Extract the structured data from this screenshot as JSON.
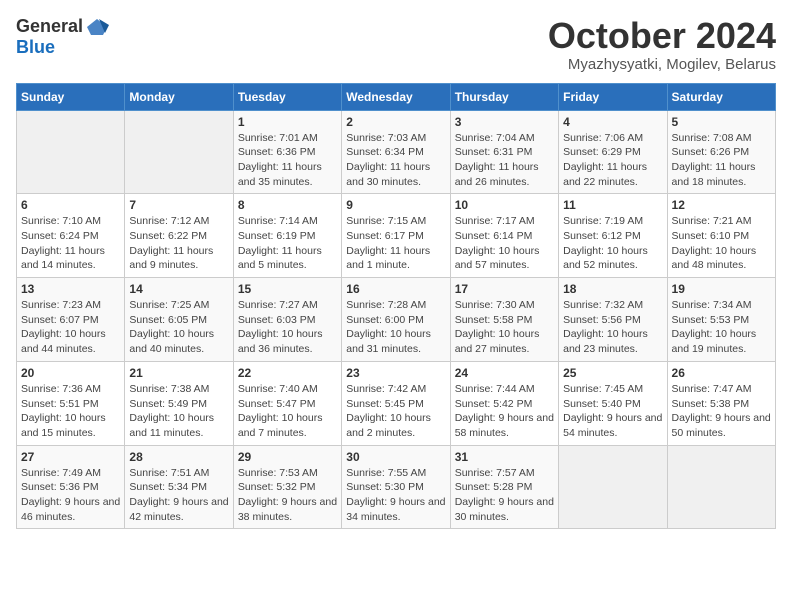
{
  "header": {
    "logo_general": "General",
    "logo_blue": "Blue",
    "month_title": "October 2024",
    "subtitle": "Myazhysyatki, Mogilev, Belarus"
  },
  "weekdays": [
    "Sunday",
    "Monday",
    "Tuesday",
    "Wednesday",
    "Thursday",
    "Friday",
    "Saturday"
  ],
  "weeks": [
    [
      {
        "num": "",
        "sunrise": "",
        "sunset": "",
        "daylight": "",
        "empty": true
      },
      {
        "num": "",
        "sunrise": "",
        "sunset": "",
        "daylight": "",
        "empty": true
      },
      {
        "num": "1",
        "sunrise": "Sunrise: 7:01 AM",
        "sunset": "Sunset: 6:36 PM",
        "daylight": "Daylight: 11 hours and 35 minutes.",
        "empty": false
      },
      {
        "num": "2",
        "sunrise": "Sunrise: 7:03 AM",
        "sunset": "Sunset: 6:34 PM",
        "daylight": "Daylight: 11 hours and 30 minutes.",
        "empty": false
      },
      {
        "num": "3",
        "sunrise": "Sunrise: 7:04 AM",
        "sunset": "Sunset: 6:31 PM",
        "daylight": "Daylight: 11 hours and 26 minutes.",
        "empty": false
      },
      {
        "num": "4",
        "sunrise": "Sunrise: 7:06 AM",
        "sunset": "Sunset: 6:29 PM",
        "daylight": "Daylight: 11 hours and 22 minutes.",
        "empty": false
      },
      {
        "num": "5",
        "sunrise": "Sunrise: 7:08 AM",
        "sunset": "Sunset: 6:26 PM",
        "daylight": "Daylight: 11 hours and 18 minutes.",
        "empty": false
      }
    ],
    [
      {
        "num": "6",
        "sunrise": "Sunrise: 7:10 AM",
        "sunset": "Sunset: 6:24 PM",
        "daylight": "Daylight: 11 hours and 14 minutes.",
        "empty": false
      },
      {
        "num": "7",
        "sunrise": "Sunrise: 7:12 AM",
        "sunset": "Sunset: 6:22 PM",
        "daylight": "Daylight: 11 hours and 9 minutes.",
        "empty": false
      },
      {
        "num": "8",
        "sunrise": "Sunrise: 7:14 AM",
        "sunset": "Sunset: 6:19 PM",
        "daylight": "Daylight: 11 hours and 5 minutes.",
        "empty": false
      },
      {
        "num": "9",
        "sunrise": "Sunrise: 7:15 AM",
        "sunset": "Sunset: 6:17 PM",
        "daylight": "Daylight: 11 hours and 1 minute.",
        "empty": false
      },
      {
        "num": "10",
        "sunrise": "Sunrise: 7:17 AM",
        "sunset": "Sunset: 6:14 PM",
        "daylight": "Daylight: 10 hours and 57 minutes.",
        "empty": false
      },
      {
        "num": "11",
        "sunrise": "Sunrise: 7:19 AM",
        "sunset": "Sunset: 6:12 PM",
        "daylight": "Daylight: 10 hours and 52 minutes.",
        "empty": false
      },
      {
        "num": "12",
        "sunrise": "Sunrise: 7:21 AM",
        "sunset": "Sunset: 6:10 PM",
        "daylight": "Daylight: 10 hours and 48 minutes.",
        "empty": false
      }
    ],
    [
      {
        "num": "13",
        "sunrise": "Sunrise: 7:23 AM",
        "sunset": "Sunset: 6:07 PM",
        "daylight": "Daylight: 10 hours and 44 minutes.",
        "empty": false
      },
      {
        "num": "14",
        "sunrise": "Sunrise: 7:25 AM",
        "sunset": "Sunset: 6:05 PM",
        "daylight": "Daylight: 10 hours and 40 minutes.",
        "empty": false
      },
      {
        "num": "15",
        "sunrise": "Sunrise: 7:27 AM",
        "sunset": "Sunset: 6:03 PM",
        "daylight": "Daylight: 10 hours and 36 minutes.",
        "empty": false
      },
      {
        "num": "16",
        "sunrise": "Sunrise: 7:28 AM",
        "sunset": "Sunset: 6:00 PM",
        "daylight": "Daylight: 10 hours and 31 minutes.",
        "empty": false
      },
      {
        "num": "17",
        "sunrise": "Sunrise: 7:30 AM",
        "sunset": "Sunset: 5:58 PM",
        "daylight": "Daylight: 10 hours and 27 minutes.",
        "empty": false
      },
      {
        "num": "18",
        "sunrise": "Sunrise: 7:32 AM",
        "sunset": "Sunset: 5:56 PM",
        "daylight": "Daylight: 10 hours and 23 minutes.",
        "empty": false
      },
      {
        "num": "19",
        "sunrise": "Sunrise: 7:34 AM",
        "sunset": "Sunset: 5:53 PM",
        "daylight": "Daylight: 10 hours and 19 minutes.",
        "empty": false
      }
    ],
    [
      {
        "num": "20",
        "sunrise": "Sunrise: 7:36 AM",
        "sunset": "Sunset: 5:51 PM",
        "daylight": "Daylight: 10 hours and 15 minutes.",
        "empty": false
      },
      {
        "num": "21",
        "sunrise": "Sunrise: 7:38 AM",
        "sunset": "Sunset: 5:49 PM",
        "daylight": "Daylight: 10 hours and 11 minutes.",
        "empty": false
      },
      {
        "num": "22",
        "sunrise": "Sunrise: 7:40 AM",
        "sunset": "Sunset: 5:47 PM",
        "daylight": "Daylight: 10 hours and 7 minutes.",
        "empty": false
      },
      {
        "num": "23",
        "sunrise": "Sunrise: 7:42 AM",
        "sunset": "Sunset: 5:45 PM",
        "daylight": "Daylight: 10 hours and 2 minutes.",
        "empty": false
      },
      {
        "num": "24",
        "sunrise": "Sunrise: 7:44 AM",
        "sunset": "Sunset: 5:42 PM",
        "daylight": "Daylight: 9 hours and 58 minutes.",
        "empty": false
      },
      {
        "num": "25",
        "sunrise": "Sunrise: 7:45 AM",
        "sunset": "Sunset: 5:40 PM",
        "daylight": "Daylight: 9 hours and 54 minutes.",
        "empty": false
      },
      {
        "num": "26",
        "sunrise": "Sunrise: 7:47 AM",
        "sunset": "Sunset: 5:38 PM",
        "daylight": "Daylight: 9 hours and 50 minutes.",
        "empty": false
      }
    ],
    [
      {
        "num": "27",
        "sunrise": "Sunrise: 7:49 AM",
        "sunset": "Sunset: 5:36 PM",
        "daylight": "Daylight: 9 hours and 46 minutes.",
        "empty": false
      },
      {
        "num": "28",
        "sunrise": "Sunrise: 7:51 AM",
        "sunset": "Sunset: 5:34 PM",
        "daylight": "Daylight: 9 hours and 42 minutes.",
        "empty": false
      },
      {
        "num": "29",
        "sunrise": "Sunrise: 7:53 AM",
        "sunset": "Sunset: 5:32 PM",
        "daylight": "Daylight: 9 hours and 38 minutes.",
        "empty": false
      },
      {
        "num": "30",
        "sunrise": "Sunrise: 7:55 AM",
        "sunset": "Sunset: 5:30 PM",
        "daylight": "Daylight: 9 hours and 34 minutes.",
        "empty": false
      },
      {
        "num": "31",
        "sunrise": "Sunrise: 7:57 AM",
        "sunset": "Sunset: 5:28 PM",
        "daylight": "Daylight: 9 hours and 30 minutes.",
        "empty": false
      },
      {
        "num": "",
        "sunrise": "",
        "sunset": "",
        "daylight": "",
        "empty": true
      },
      {
        "num": "",
        "sunrise": "",
        "sunset": "",
        "daylight": "",
        "empty": true
      }
    ]
  ]
}
